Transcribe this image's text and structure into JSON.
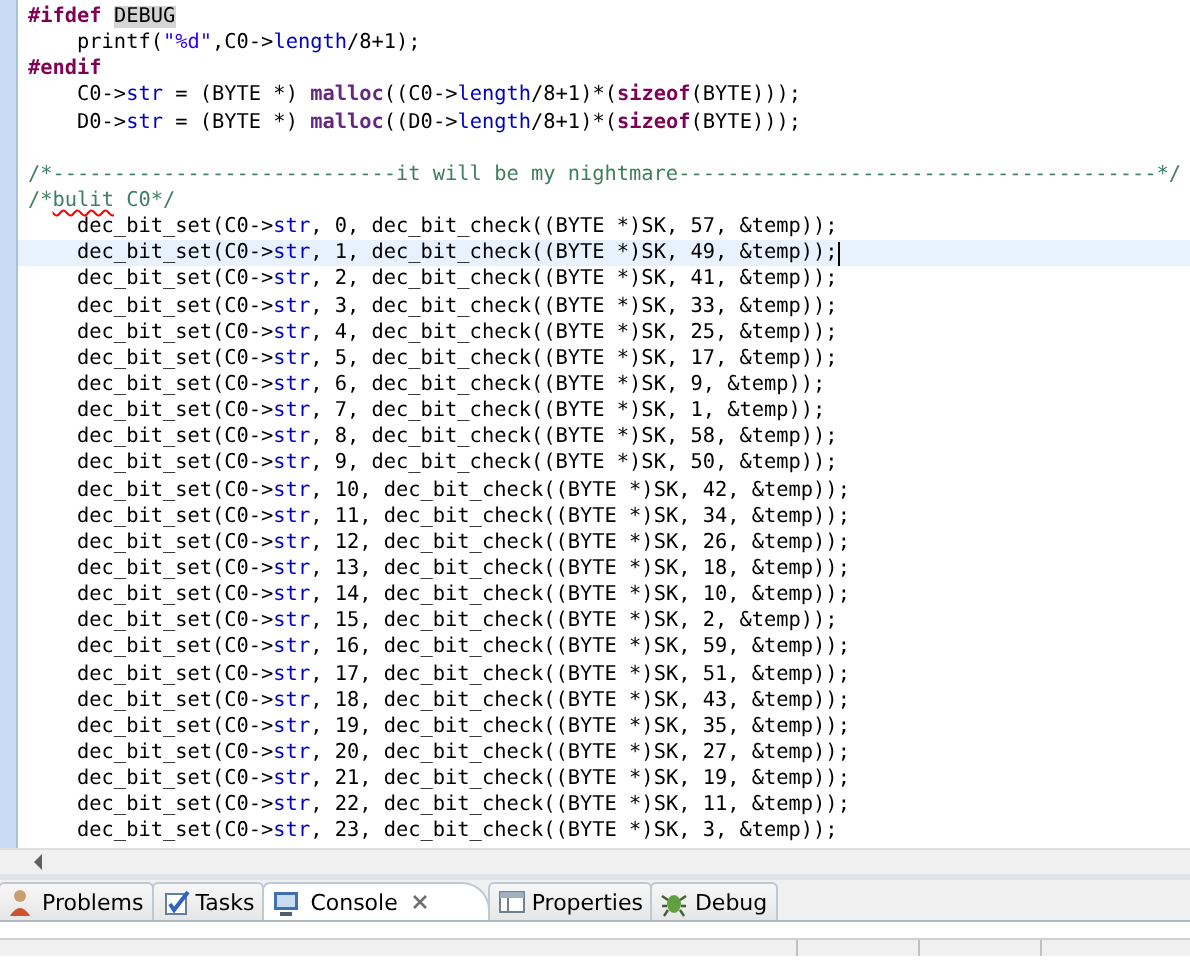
{
  "editor": {
    "lines": [
      {
        "kind": "code",
        "selected": false,
        "segments": [
          {
            "kind": "preproc",
            "t": "#ifdef "
          },
          {
            "kind": "occurrence",
            "t": "DEBUG"
          }
        ]
      },
      {
        "kind": "code",
        "selected": false,
        "segments": [
          {
            "kind": "plain",
            "t": "    printf("
          },
          {
            "kind": "string",
            "t": "\"%d\""
          },
          {
            "kind": "plain",
            "t": ",C0->"
          },
          {
            "kind": "field",
            "t": "length"
          },
          {
            "kind": "plain",
            "t": "/8+1);"
          }
        ]
      },
      {
        "kind": "code",
        "selected": false,
        "segments": [
          {
            "kind": "preproc",
            "t": "#endif"
          }
        ]
      },
      {
        "kind": "code",
        "selected": false,
        "segments": [
          {
            "kind": "plain",
            "t": "    C0->"
          },
          {
            "kind": "field",
            "t": "str"
          },
          {
            "kind": "plain",
            "t": " = (BYTE *) "
          },
          {
            "kind": "func",
            "t": "malloc"
          },
          {
            "kind": "plain",
            "t": "((C0->"
          },
          {
            "kind": "field",
            "t": "length"
          },
          {
            "kind": "plain",
            "t": "/8+1)*("
          },
          {
            "kind": "keyword",
            "t": "sizeof"
          },
          {
            "kind": "plain",
            "t": "(BYTE)));"
          }
        ]
      },
      {
        "kind": "code",
        "selected": false,
        "segments": [
          {
            "kind": "plain",
            "t": "    D0->"
          },
          {
            "kind": "field",
            "t": "str"
          },
          {
            "kind": "plain",
            "t": " = (BYTE *) "
          },
          {
            "kind": "func",
            "t": "malloc"
          },
          {
            "kind": "plain",
            "t": "((D0->"
          },
          {
            "kind": "field",
            "t": "length"
          },
          {
            "kind": "plain",
            "t": "/8+1)*("
          },
          {
            "kind": "keyword",
            "t": "sizeof"
          },
          {
            "kind": "plain",
            "t": "(BYTE)));"
          }
        ]
      },
      {
        "kind": "blank",
        "selected": false
      },
      {
        "kind": "code",
        "selected": false,
        "segments": [
          {
            "kind": "comment",
            "t": "/*----------------------------it will be my nightmare---------------------------------------*/"
          }
        ]
      },
      {
        "kind": "code",
        "selected": false,
        "segments": [
          {
            "kind": "comment",
            "t": "/*"
          },
          {
            "kind": "misspelled",
            "t": "bulit"
          },
          {
            "kind": "comment",
            "t": " C0*/"
          }
        ]
      },
      {
        "kind": "code",
        "selected": false,
        "segments": [
          {
            "kind": "plain",
            "t": "    dec_bit_set(C0->"
          },
          {
            "kind": "field",
            "t": "str"
          },
          {
            "kind": "plain",
            "t": ", 0, dec_bit_check((BYTE *)SK, 57, &temp));"
          }
        ]
      },
      {
        "kind": "code",
        "selected": true,
        "segments": [
          {
            "kind": "plain",
            "t": "    dec_bit_set(C0->"
          },
          {
            "kind": "field",
            "t": "str"
          },
          {
            "kind": "plain",
            "t": ", 1, dec_bit_check((BYTE *)SK, 49, &temp));"
          }
        ]
      },
      {
        "kind": "code",
        "selected": false,
        "segments": [
          {
            "kind": "plain",
            "t": "    dec_bit_set(C0->"
          },
          {
            "kind": "field",
            "t": "str"
          },
          {
            "kind": "plain",
            "t": ", 2, dec_bit_check((BYTE *)SK, 41, &temp));"
          }
        ]
      },
      {
        "kind": "code",
        "selected": false,
        "segments": [
          {
            "kind": "plain",
            "t": "    dec_bit_set(C0->"
          },
          {
            "kind": "field",
            "t": "str"
          },
          {
            "kind": "plain",
            "t": ", 3, dec_bit_check((BYTE *)SK, 33, &temp));"
          }
        ]
      },
      {
        "kind": "code",
        "selected": false,
        "segments": [
          {
            "kind": "plain",
            "t": "    dec_bit_set(C0->"
          },
          {
            "kind": "field",
            "t": "str"
          },
          {
            "kind": "plain",
            "t": ", 4, dec_bit_check((BYTE *)SK, 25, &temp));"
          }
        ]
      },
      {
        "kind": "code",
        "selected": false,
        "segments": [
          {
            "kind": "plain",
            "t": "    dec_bit_set(C0->"
          },
          {
            "kind": "field",
            "t": "str"
          },
          {
            "kind": "plain",
            "t": ", 5, dec_bit_check((BYTE *)SK, 17, &temp));"
          }
        ]
      },
      {
        "kind": "code",
        "selected": false,
        "segments": [
          {
            "kind": "plain",
            "t": "    dec_bit_set(C0->"
          },
          {
            "kind": "field",
            "t": "str"
          },
          {
            "kind": "plain",
            "t": ", 6, dec_bit_check((BYTE *)SK, 9, &temp));"
          }
        ]
      },
      {
        "kind": "code",
        "selected": false,
        "segments": [
          {
            "kind": "plain",
            "t": "    dec_bit_set(C0->"
          },
          {
            "kind": "field",
            "t": "str"
          },
          {
            "kind": "plain",
            "t": ", 7, dec_bit_check((BYTE *)SK, 1, &temp));"
          }
        ]
      },
      {
        "kind": "code",
        "selected": false,
        "segments": [
          {
            "kind": "plain",
            "t": "    dec_bit_set(C0->"
          },
          {
            "kind": "field",
            "t": "str"
          },
          {
            "kind": "plain",
            "t": ", 8, dec_bit_check((BYTE *)SK, 58, &temp));"
          }
        ]
      },
      {
        "kind": "code",
        "selected": false,
        "segments": [
          {
            "kind": "plain",
            "t": "    dec_bit_set(C0->"
          },
          {
            "kind": "field",
            "t": "str"
          },
          {
            "kind": "plain",
            "t": ", 9, dec_bit_check((BYTE *)SK, 50, &temp));"
          }
        ]
      },
      {
        "kind": "code",
        "selected": false,
        "segments": [
          {
            "kind": "plain",
            "t": "    dec_bit_set(C0->"
          },
          {
            "kind": "field",
            "t": "str"
          },
          {
            "kind": "plain",
            "t": ", 10, dec_bit_check((BYTE *)SK, 42, &temp));"
          }
        ]
      },
      {
        "kind": "code",
        "selected": false,
        "segments": [
          {
            "kind": "plain",
            "t": "    dec_bit_set(C0->"
          },
          {
            "kind": "field",
            "t": "str"
          },
          {
            "kind": "plain",
            "t": ", 11, dec_bit_check((BYTE *)SK, 34, &temp));"
          }
        ]
      },
      {
        "kind": "code",
        "selected": false,
        "segments": [
          {
            "kind": "plain",
            "t": "    dec_bit_set(C0->"
          },
          {
            "kind": "field",
            "t": "str"
          },
          {
            "kind": "plain",
            "t": ", 12, dec_bit_check((BYTE *)SK, 26, &temp));"
          }
        ]
      },
      {
        "kind": "code",
        "selected": false,
        "segments": [
          {
            "kind": "plain",
            "t": "    dec_bit_set(C0->"
          },
          {
            "kind": "field",
            "t": "str"
          },
          {
            "kind": "plain",
            "t": ", 13, dec_bit_check((BYTE *)SK, 18, &temp));"
          }
        ]
      },
      {
        "kind": "code",
        "selected": false,
        "segments": [
          {
            "kind": "plain",
            "t": "    dec_bit_set(C0->"
          },
          {
            "kind": "field",
            "t": "str"
          },
          {
            "kind": "plain",
            "t": ", 14, dec_bit_check((BYTE *)SK, 10, &temp));"
          }
        ]
      },
      {
        "kind": "code",
        "selected": false,
        "segments": [
          {
            "kind": "plain",
            "t": "    dec_bit_set(C0->"
          },
          {
            "kind": "field",
            "t": "str"
          },
          {
            "kind": "plain",
            "t": ", 15, dec_bit_check((BYTE *)SK, 2, &temp));"
          }
        ]
      },
      {
        "kind": "code",
        "selected": false,
        "segments": [
          {
            "kind": "plain",
            "t": "    dec_bit_set(C0->"
          },
          {
            "kind": "field",
            "t": "str"
          },
          {
            "kind": "plain",
            "t": ", 16, dec_bit_check((BYTE *)SK, 59, &temp));"
          }
        ]
      },
      {
        "kind": "code",
        "selected": false,
        "segments": [
          {
            "kind": "plain",
            "t": "    dec_bit_set(C0->"
          },
          {
            "kind": "field",
            "t": "str"
          },
          {
            "kind": "plain",
            "t": ", 17, dec_bit_check((BYTE *)SK, 51, &temp));"
          }
        ]
      },
      {
        "kind": "code",
        "selected": false,
        "segments": [
          {
            "kind": "plain",
            "t": "    dec_bit_set(C0->"
          },
          {
            "kind": "field",
            "t": "str"
          },
          {
            "kind": "plain",
            "t": ", 18, dec_bit_check((BYTE *)SK, 43, &temp));"
          }
        ]
      },
      {
        "kind": "code",
        "selected": false,
        "segments": [
          {
            "kind": "plain",
            "t": "    dec_bit_set(C0->"
          },
          {
            "kind": "field",
            "t": "str"
          },
          {
            "kind": "plain",
            "t": ", 19, dec_bit_check((BYTE *)SK, 35, &temp));"
          }
        ]
      },
      {
        "kind": "code",
        "selected": false,
        "segments": [
          {
            "kind": "plain",
            "t": "    dec_bit_set(C0->"
          },
          {
            "kind": "field",
            "t": "str"
          },
          {
            "kind": "plain",
            "t": ", 20, dec_bit_check((BYTE *)SK, 27, &temp));"
          }
        ]
      },
      {
        "kind": "code",
        "selected": false,
        "segments": [
          {
            "kind": "plain",
            "t": "    dec_bit_set(C0->"
          },
          {
            "kind": "field",
            "t": "str"
          },
          {
            "kind": "plain",
            "t": ", 21, dec_bit_check((BYTE *)SK, 19, &temp));"
          }
        ]
      },
      {
        "kind": "code",
        "selected": false,
        "segments": [
          {
            "kind": "plain",
            "t": "    dec_bit_set(C0->"
          },
          {
            "kind": "field",
            "t": "str"
          },
          {
            "kind": "plain",
            "t": ", 22, dec_bit_check((BYTE *)SK, 11, &temp));"
          }
        ]
      },
      {
        "kind": "code",
        "selected": false,
        "segments": [
          {
            "kind": "plain",
            "t": "    dec_bit_set(C0->"
          },
          {
            "kind": "field",
            "t": "str"
          },
          {
            "kind": "plain",
            "t": ", 23, dec_bit_check((BYTE *)SK, 3, &temp));"
          }
        ]
      }
    ]
  },
  "tabs": [
    {
      "label": "Problems",
      "kind": "problems",
      "selected": false
    },
    {
      "label": "Tasks",
      "kind": "tasks",
      "selected": false
    },
    {
      "label": "Console",
      "kind": "console",
      "selected": true
    },
    {
      "label": "Properties",
      "kind": "properties",
      "selected": false
    },
    {
      "label": "Debug",
      "kind": "debug",
      "selected": false
    }
  ]
}
